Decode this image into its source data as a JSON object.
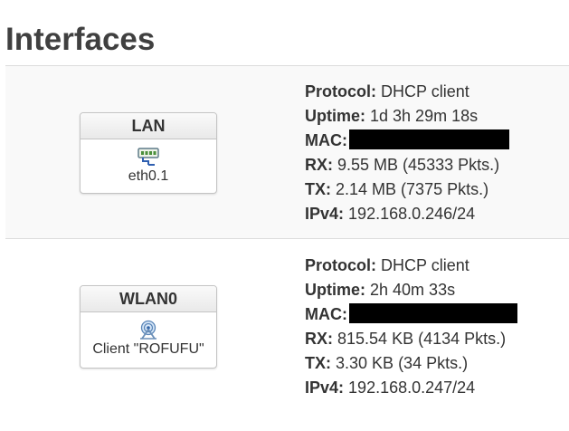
{
  "page": {
    "title": "Interfaces"
  },
  "interfaces": [
    {
      "name": "LAN",
      "device": "eth0.1",
      "icon": "ethernet-port-icon",
      "labels": {
        "protocol": "Protocol:",
        "uptime": "Uptime:",
        "mac": "MAC:",
        "rx": "RX:",
        "tx": "TX:",
        "ipv4": "IPv4:"
      },
      "protocol": "DHCP client",
      "uptime": "1d 3h 29m 18s",
      "mac": "",
      "rx": "9.55 MB (45333 Pkts.)",
      "tx": "2.14 MB (7375 Pkts.)",
      "ipv4": "192.168.0.246/24"
    },
    {
      "name": "WLAN0",
      "device": "Client \"ROFUFU\"",
      "icon": "wifi-signal-icon",
      "labels": {
        "protocol": "Protocol:",
        "uptime": "Uptime:",
        "mac": "MAC:",
        "rx": "RX:",
        "tx": "TX:",
        "ipv4": "IPv4:"
      },
      "protocol": "DHCP client",
      "uptime": "2h 40m 33s",
      "mac": "",
      "rx": "815.54 KB (4134 Pkts.)",
      "tx": "3.30 KB (34 Pkts.)",
      "ipv4": "192.168.0.247/24"
    }
  ],
  "colors": {
    "title": "#404040",
    "text": "#333333",
    "row_alt": "#f9f9f9",
    "redaction": "#000000"
  }
}
